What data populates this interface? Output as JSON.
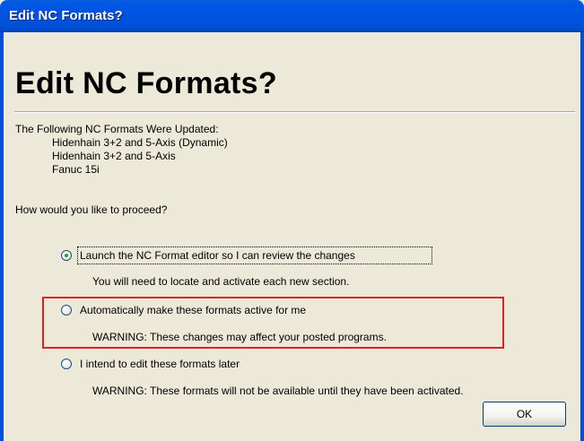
{
  "window": {
    "title": "Edit NC Formats?"
  },
  "heading": "Edit NC Formats?",
  "updated_intro": "The Following NC Formats Were Updated:",
  "updated_formats": [
    "Hidenhain 3+2 and 5-Axis (Dynamic)",
    "Hidenhain 3+2 and 5-Axis",
    "Fanuc 15i"
  ],
  "question": "How would you like to proceed?",
  "options": [
    {
      "label": "Launch the NC Format editor so I can review the changes",
      "note": "You will need to locate and activate each new section.",
      "selected": true
    },
    {
      "label": "Automatically make these formats active for me",
      "note": "WARNING: These changes may affect your posted programs.",
      "selected": false
    },
    {
      "label": "I intend to edit these formats later",
      "note": "WARNING: These formats will not be available until they have been activated.",
      "selected": false
    }
  ],
  "buttons": {
    "ok_label": "OK"
  },
  "colors": {
    "titlebar": "#0053e1",
    "dialog_bg": "#ece9d8",
    "highlight_border": "#e31e24",
    "radio_dot": "#21a121"
  }
}
